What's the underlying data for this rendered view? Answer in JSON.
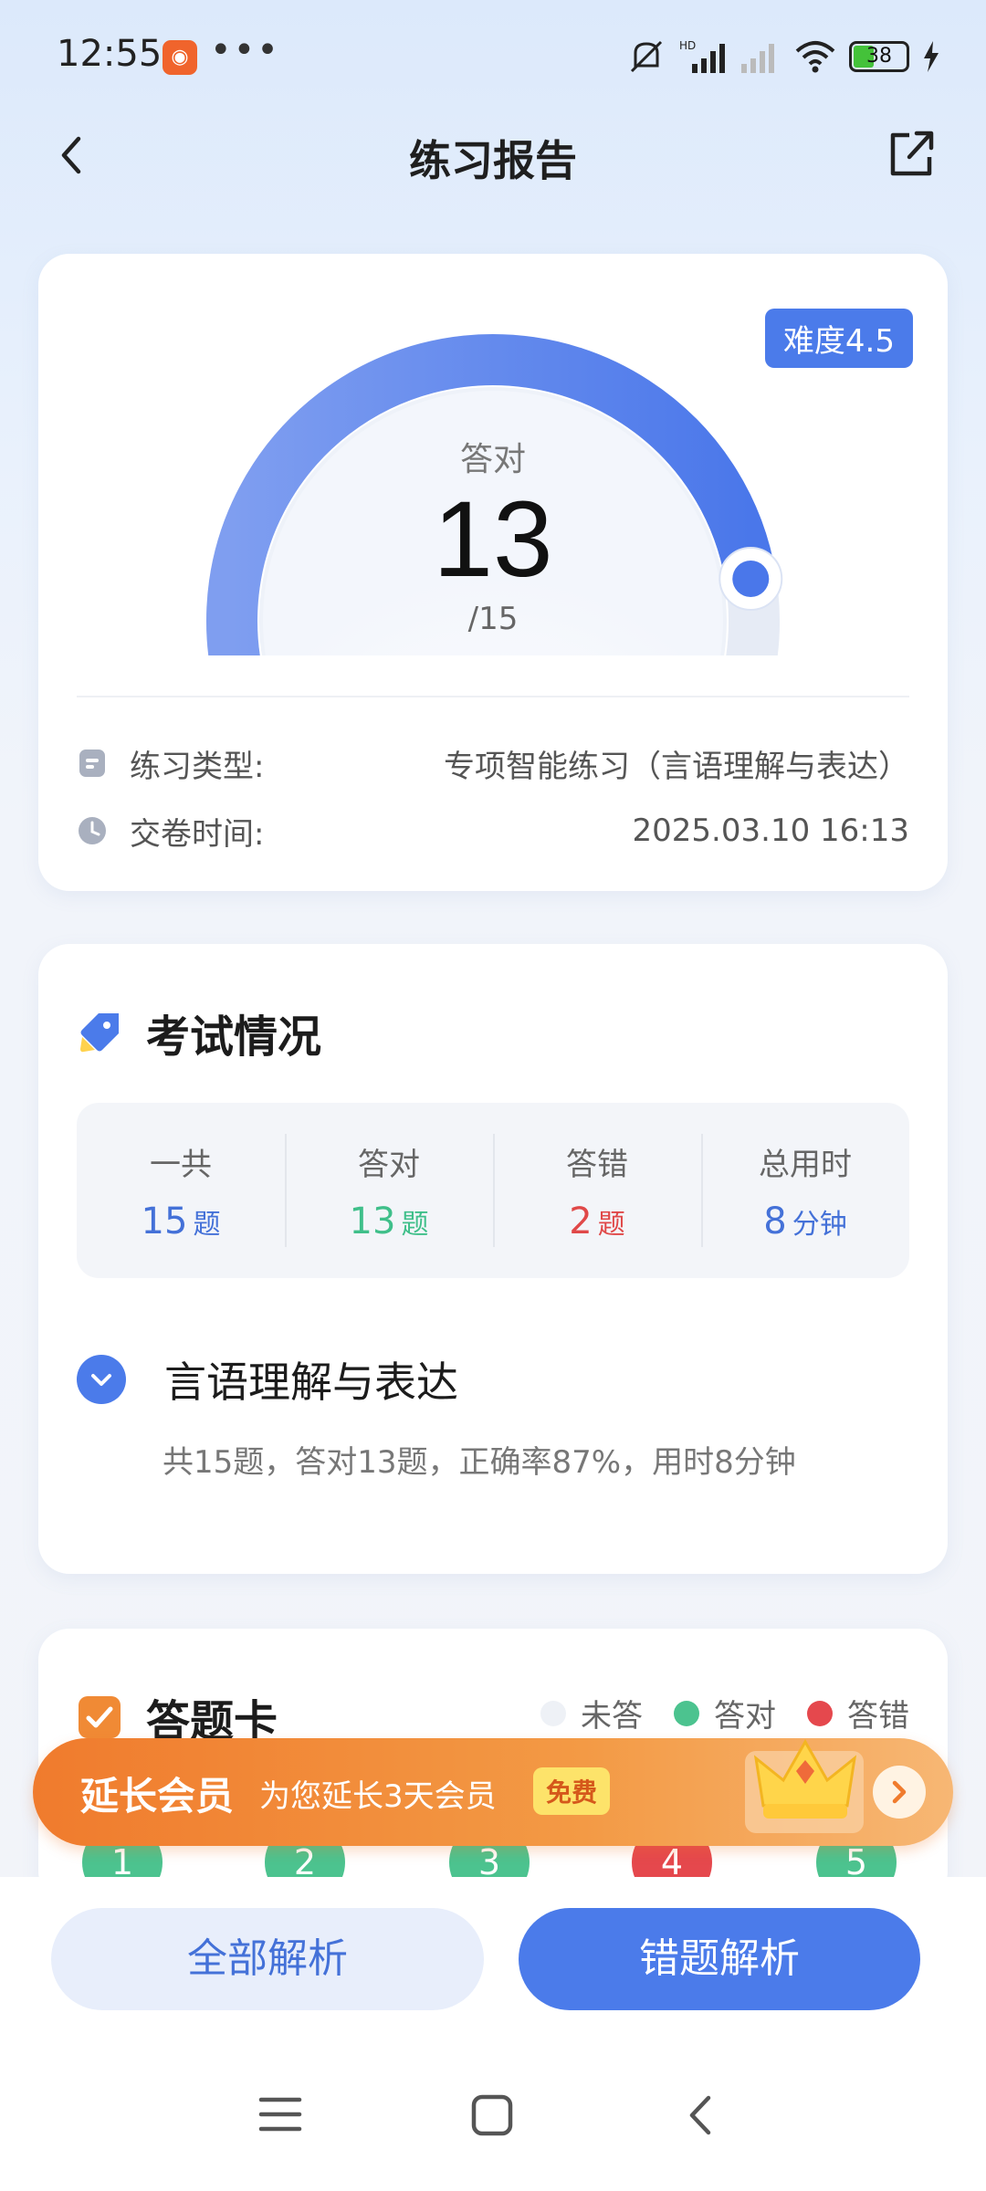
{
  "status_bar": {
    "time": "12:55",
    "dots": "•••",
    "battery": "38"
  },
  "nav": {
    "title": "练习报告"
  },
  "score_card": {
    "difficulty": "难度4.5",
    "label": "答对",
    "correct": "13",
    "total": "/15",
    "correct_fraction": 0.867,
    "practice_type_label": "练习类型:",
    "practice_type_value": "专项智能练习（言语理解与表达）",
    "submit_time_label": "交卷时间:",
    "submit_time_value": "2025.03.10 16:13"
  },
  "exam": {
    "title": "考试情况",
    "stats": [
      {
        "label": "一共",
        "value": "15",
        "unit": "题",
        "color": "#4471d8"
      },
      {
        "label": "答对",
        "value": "13",
        "unit": "题",
        "color": "#3fbf8a"
      },
      {
        "label": "答错",
        "value": "2",
        "unit": "题",
        "color": "#e04848"
      },
      {
        "label": "总用时",
        "value": "8",
        "unit": "分钟",
        "color": "#4471d8"
      }
    ],
    "category_title": "言语理解与表达",
    "category_summary": "共15题，答对13题，正确率87%，用时8分钟"
  },
  "answer_card": {
    "title": "答题卡",
    "legend": [
      {
        "label": "未答",
        "color": "#eef1f6"
      },
      {
        "label": "答对",
        "color": "#4cc38f"
      },
      {
        "label": "答错",
        "color": "#e5484d"
      }
    ],
    "questions": [
      {
        "n": "1",
        "status": "correct"
      },
      {
        "n": "2",
        "status": "correct"
      },
      {
        "n": "3",
        "status": "correct"
      },
      {
        "n": "4",
        "status": "wrong"
      },
      {
        "n": "5",
        "status": "correct"
      }
    ]
  },
  "promo": {
    "title": "延长会员",
    "desc": "为您延长3天会员",
    "badge": "免费"
  },
  "buttons": {
    "all": "全部解析",
    "wrong": "错题解析"
  },
  "colors": {
    "accent": "#4b7bea",
    "correct": "#4cc38f",
    "wrong": "#e5484d",
    "promo": "#f07b2d"
  }
}
